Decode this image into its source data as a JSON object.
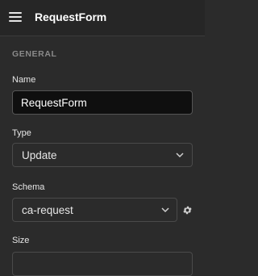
{
  "header": {
    "title": "RequestForm",
    "menu_icon": "hamburger-menu-icon"
  },
  "section": {
    "title": "GENERAL"
  },
  "fields": {
    "name": {
      "label": "Name",
      "value": "RequestForm"
    },
    "type": {
      "label": "Type",
      "value": "Update",
      "icon": "chevron-down-icon"
    },
    "schema": {
      "label": "Schema",
      "value": "ca-request",
      "icon": "chevron-down-icon",
      "settings_icon": "gear-icon"
    },
    "size": {
      "label": "Size"
    }
  },
  "colors": {
    "background": "#2b2b2b",
    "header_background": "#262626",
    "input_background": "#0f0f0f",
    "border": "#4a4a4a",
    "muted_text": "#8a8a8a"
  }
}
